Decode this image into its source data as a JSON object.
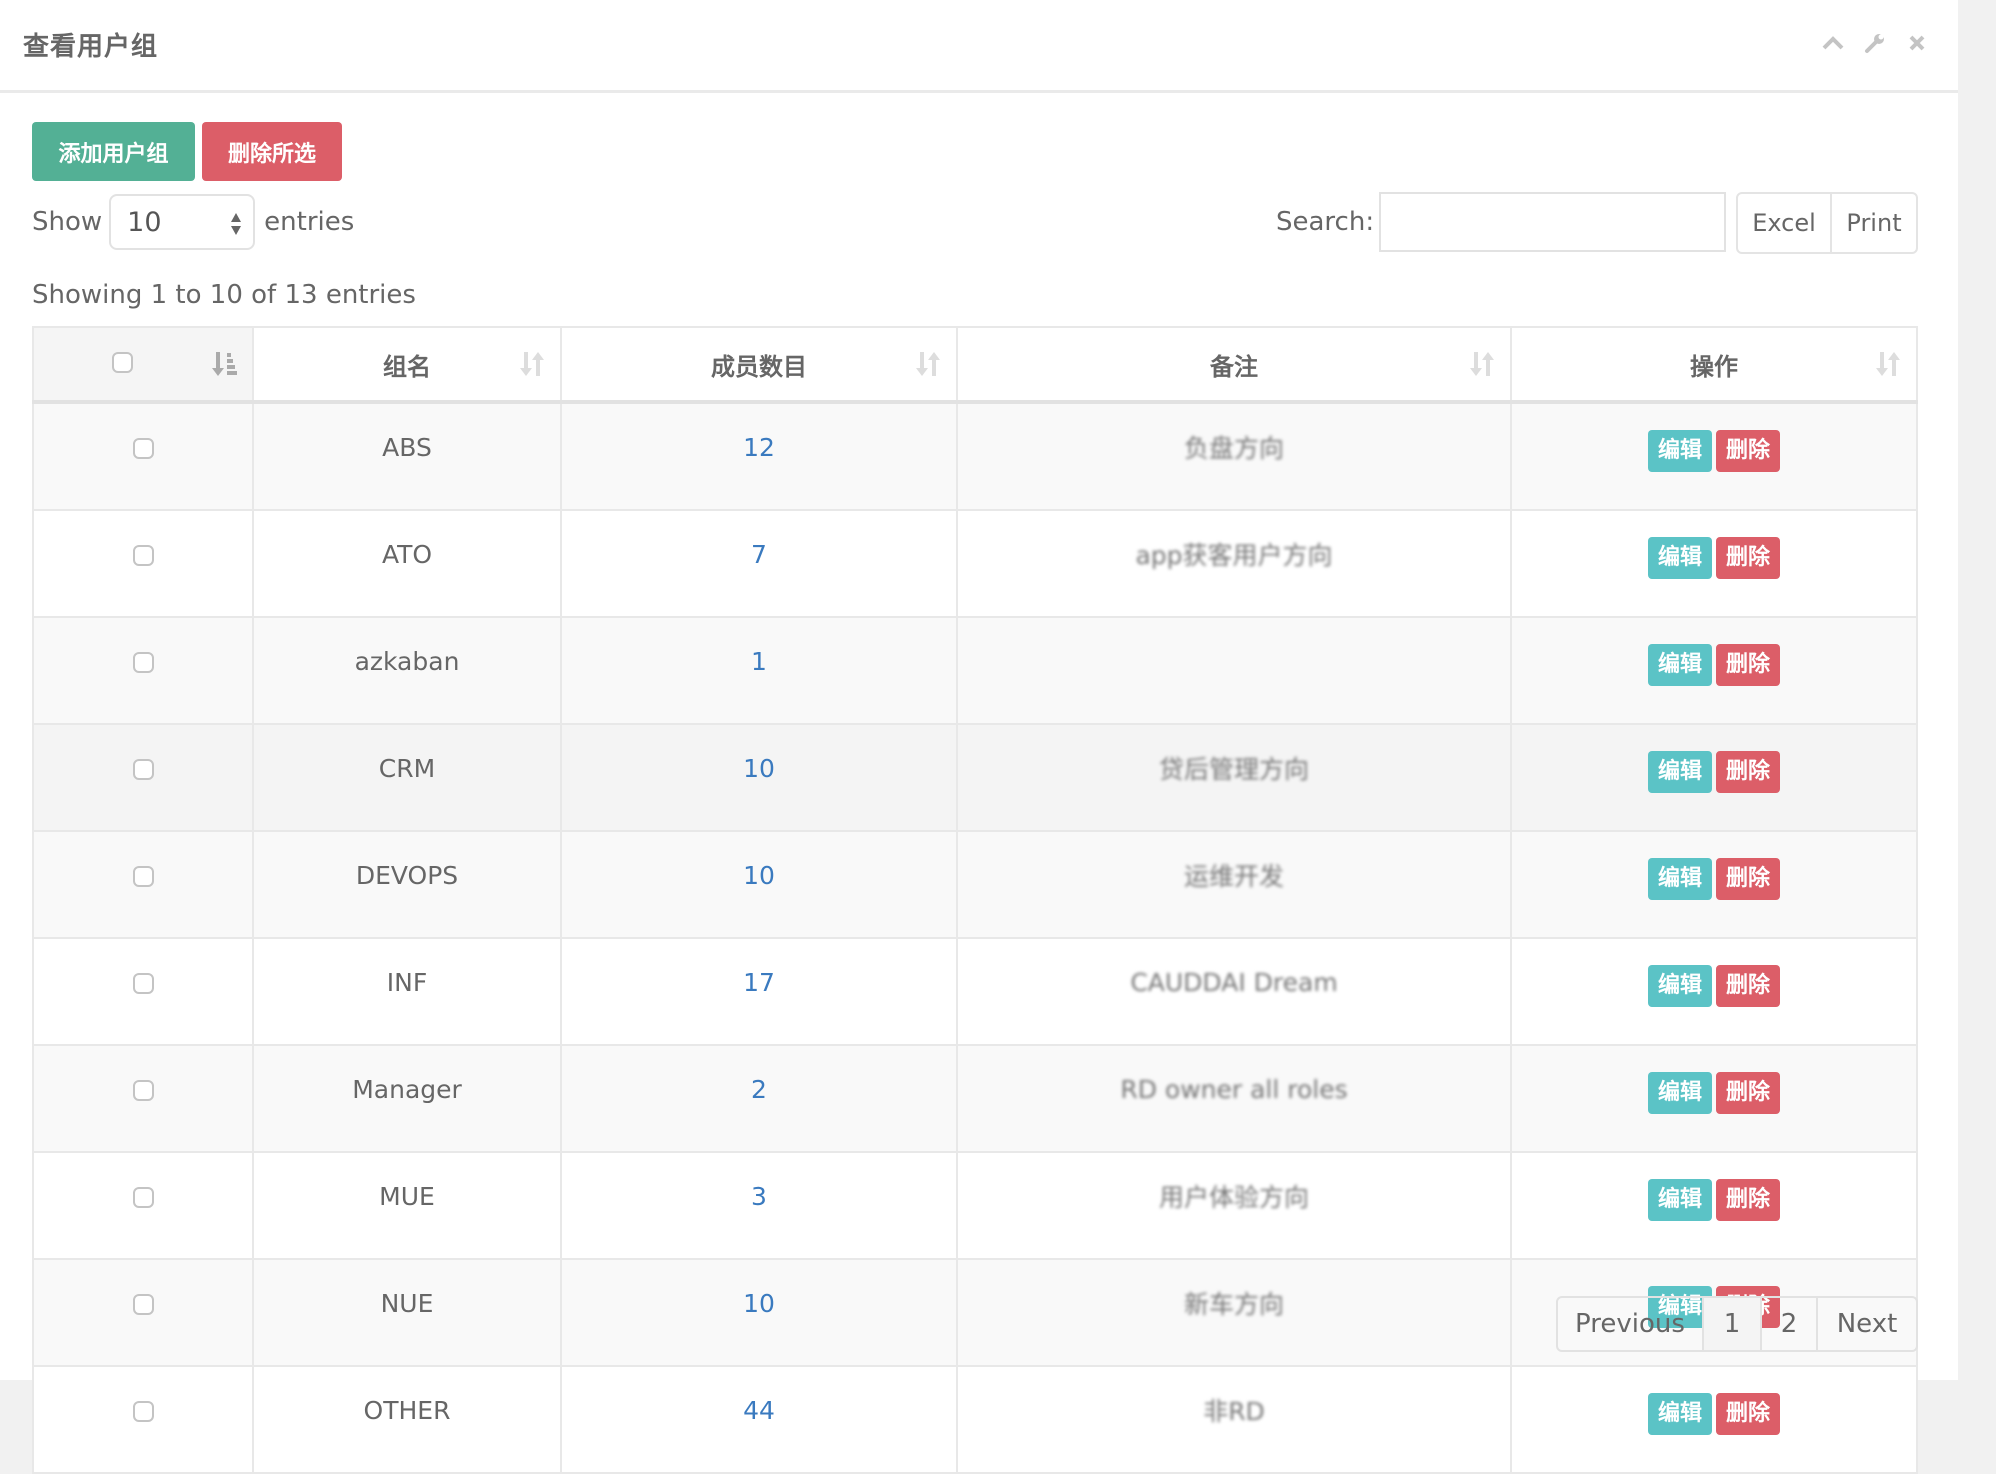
{
  "panel": {
    "title": "查看用户组",
    "icons": [
      "chevron-up-icon",
      "wrench-icon",
      "close-icon"
    ]
  },
  "toolbar": {
    "add_label": "添加用户组",
    "delete_selected_label": "删除所选",
    "add_color": "#53b095",
    "delete_color": "#dc5e68"
  },
  "length": {
    "show_label": "Show",
    "value": "10",
    "entries_label": "entries"
  },
  "search": {
    "label": "Search:",
    "value": "",
    "placeholder": ""
  },
  "export": {
    "excel_label": "Excel",
    "print_label": "Print"
  },
  "info": "Showing 1 to 10 of 13 entries",
  "table": {
    "columns": [
      "",
      "组名",
      "成员数目",
      "备注",
      "操作"
    ],
    "edit_label": "编辑",
    "delete_label": "删除",
    "rows": [
      {
        "name": "ABS",
        "members": "12",
        "remark": "负盘方向"
      },
      {
        "name": "ATO",
        "members": "7",
        "remark": "app获客用户方向"
      },
      {
        "name": "azkaban",
        "members": "1",
        "remark": ""
      },
      {
        "name": "CRM",
        "members": "10",
        "remark": "贷后管理方向"
      },
      {
        "name": "DEVOPS",
        "members": "10",
        "remark": "运维开发"
      },
      {
        "name": "INF",
        "members": "17",
        "remark": "CAUDDAI Dream"
      },
      {
        "name": "Manager",
        "members": "2",
        "remark": "RD owner all roles"
      },
      {
        "name": "MUE",
        "members": "3",
        "remark": "用户体验方向"
      },
      {
        "name": "NUE",
        "members": "10",
        "remark": "新车方向"
      },
      {
        "name": "OTHER",
        "members": "44",
        "remark": "非RD"
      }
    ]
  },
  "pagination": {
    "previous": "Previous",
    "pages": [
      "1",
      "2"
    ],
    "current": "1",
    "next": "Next"
  }
}
